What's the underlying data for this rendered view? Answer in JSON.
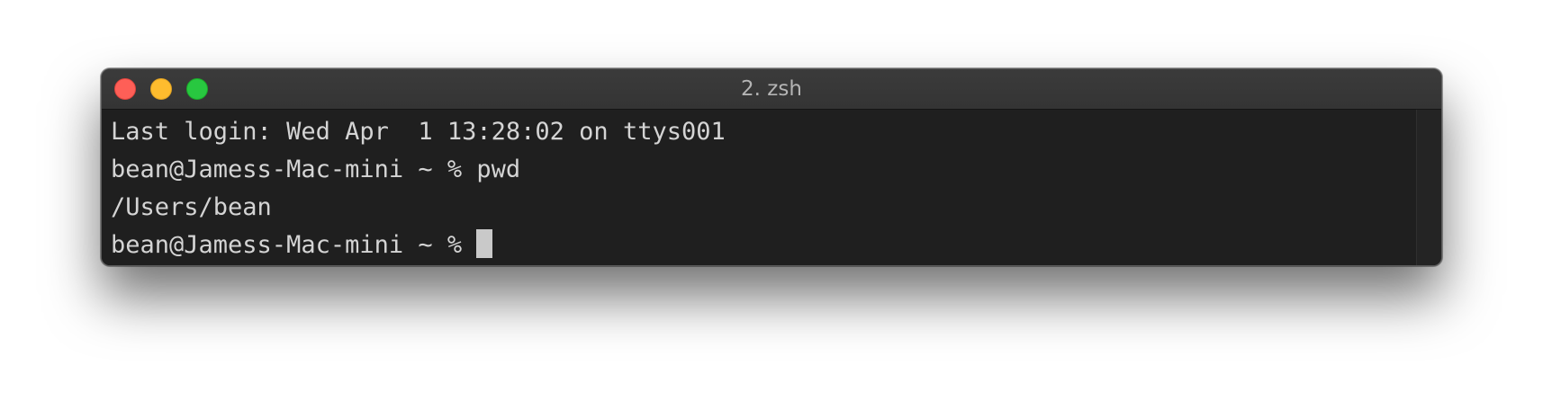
{
  "window": {
    "title": "2. zsh",
    "buttons": [
      "close",
      "minimize",
      "zoom"
    ]
  },
  "terminal": {
    "lines": [
      "Last login: Wed Apr  1 13:28:02 on ttys001",
      "bean@Jamess-Mac-mini ~ % pwd",
      "/Users/bean"
    ],
    "prompt": "bean@Jamess-Mac-mini ~ % "
  },
  "colors": {
    "background": "#1f1f1f",
    "titlebar": "#3b3b3b",
    "text": "#d4d4d4",
    "close": "#fe5f57",
    "minimize": "#febc2e",
    "zoom": "#28c840"
  }
}
